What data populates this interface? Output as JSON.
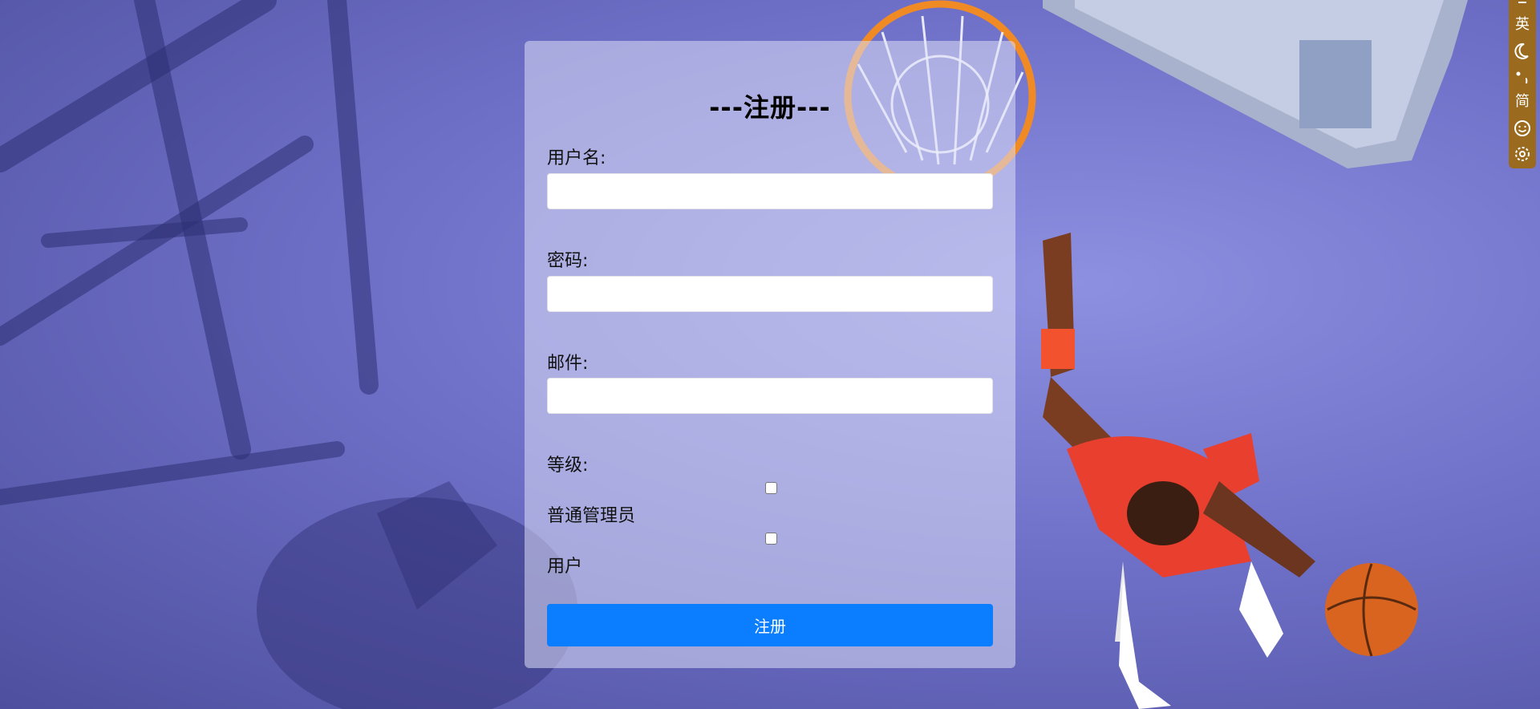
{
  "form": {
    "title": "---注册---",
    "username_label": "用户名:",
    "password_label": "密码:",
    "email_label": "邮件:",
    "level_label": "等级:",
    "level_options": [
      "普通管理员",
      "用户"
    ],
    "submit_label": "注册"
  },
  "ime_toolbar": {
    "items": [
      "英",
      "简"
    ],
    "icons": [
      "menu-icon",
      "moon-icon",
      "punctuation-icon",
      "emoji-icon",
      "settings-icon"
    ]
  },
  "colors": {
    "submit_button": "#0b7dff",
    "ime_toolbar": "#9a6b1f"
  }
}
